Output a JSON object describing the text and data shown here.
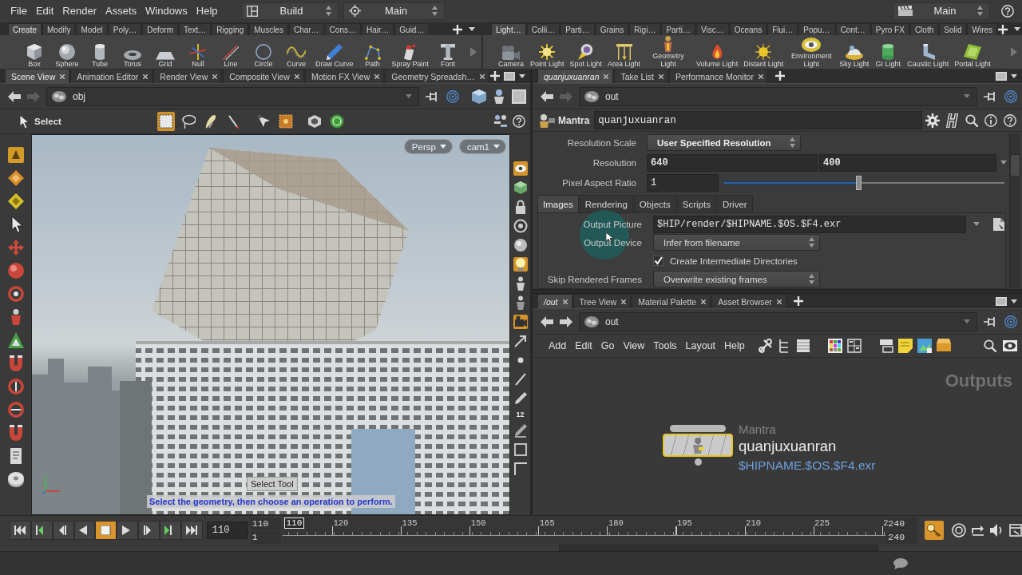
{
  "menu_bar": {
    "menus": [
      "File",
      "Edit",
      "Render",
      "Assets",
      "Windows",
      "Help"
    ],
    "desktop": "Build",
    "context": "Main",
    "right_context": "Main"
  },
  "shelves": [
    {
      "tabs": [
        {
          "label": "Create",
          "selected": true
        },
        {
          "label": "Modify",
          "selected": false
        },
        {
          "label": "Model",
          "selected": false
        },
        {
          "label": "Poly…",
          "selected": false
        },
        {
          "label": "Deform",
          "selected": false
        },
        {
          "label": "Text…",
          "selected": false
        },
        {
          "label": "Rigging",
          "selected": false
        },
        {
          "label": "Muscles",
          "selected": false
        },
        {
          "label": "Char…",
          "selected": false
        },
        {
          "label": "Cons…",
          "selected": false
        },
        {
          "label": "Hair…",
          "selected": false
        },
        {
          "label": "Guid…",
          "selected": false
        }
      ],
      "tools": [
        "Box",
        "Sphere",
        "Tube",
        "Torus",
        "Grid",
        "Null",
        "Line",
        "Circle",
        "Curve",
        "Draw Curve",
        "Path",
        "Spray Paint",
        "Font"
      ]
    },
    {
      "tabs": [
        {
          "label": "Light…",
          "selected": true
        },
        {
          "label": "Colli…",
          "selected": false
        },
        {
          "label": "Parti…",
          "selected": false
        },
        {
          "label": "Grains",
          "selected": false
        },
        {
          "label": "Rigi…",
          "selected": false
        },
        {
          "label": "Parti…",
          "selected": false
        },
        {
          "label": "Visc…",
          "selected": false
        },
        {
          "label": "Oceans",
          "selected": false
        },
        {
          "label": "Flui…",
          "selected": false
        },
        {
          "label": "Popu…",
          "selected": false
        },
        {
          "label": "Cont…",
          "selected": false
        },
        {
          "label": "Pyro FX",
          "selected": false
        },
        {
          "label": "Cloth",
          "selected": false
        },
        {
          "label": "Solid",
          "selected": false
        },
        {
          "label": "Wires",
          "selected": false
        }
      ],
      "tools": [
        "Camera",
        "Point Light",
        "Spot Light",
        "Area Light",
        "Geometry Light",
        "Volume Light",
        "Distant Light",
        "Environment Light",
        "Sky Light",
        "GI Light",
        "Caustic Light",
        "Portal Light"
      ]
    }
  ],
  "scene_pane": {
    "tabs": [
      {
        "label": "Scene View",
        "selected": true,
        "kind": "view"
      },
      {
        "label": "Animation Editor",
        "selected": false,
        "kind": "view"
      },
      {
        "label": "Render View",
        "selected": false,
        "kind": "view"
      },
      {
        "label": "Composite View",
        "selected": false,
        "kind": "view"
      },
      {
        "label": "Motion FX View",
        "selected": false,
        "kind": "view"
      },
      {
        "label": "Geometry Spreadsh…",
        "selected": false,
        "kind": "view"
      }
    ],
    "path": "obj",
    "forward_enabled": false,
    "tool": "Select",
    "selection_modes": [
      {
        "selected": true
      },
      {
        "selected": false
      },
      {
        "selected": false
      },
      {
        "selected": false
      }
    ],
    "view_menus": [
      "Persp",
      "cam1"
    ],
    "tooltip": "Select Tool",
    "prompt": "Select the geometry, then choose an operation to perform.",
    "display_options": [
      {
        "on": true
      },
      {
        "on": false
      },
      {
        "on": false
      },
      {
        "on": false
      },
      {
        "on": false
      },
      {
        "on": true
      },
      {
        "on": false
      },
      {
        "on": false
      },
      {
        "on": true
      },
      {
        "on": false
      },
      {
        "on": false
      },
      {
        "on": false
      },
      {
        "on": false
      },
      {
        "on": false
      },
      {
        "on": false
      },
      {
        "on": false
      }
    ],
    "column_label": "12"
  },
  "parameter_pane": {
    "tabs": [
      {
        "label": "quanjuxuanran",
        "selected": true,
        "kind": "path"
      },
      {
        "label": "Take List",
        "selected": false,
        "kind": "view"
      },
      {
        "label": "Performance Monitor",
        "selected": false,
        "kind": "view"
      }
    ],
    "path": "out",
    "forward_enabled": false,
    "node_type": "Mantra",
    "node_name": "quanjuxuanran",
    "parameters": [
      {
        "kind": "menu",
        "label": "Resolution Scale",
        "value": "User Specified Resolution",
        "changed": true
      },
      {
        "kind": "pair",
        "label": "Resolution",
        "values": [
          "640",
          "400"
        ],
        "changed": true
      },
      {
        "kind": "slider",
        "label": "Pixel Aspect Ratio",
        "value": "1",
        "level": 0.48,
        "changed": false
      }
    ],
    "folders": [
      {
        "label": "Images",
        "selected": true
      },
      {
        "label": "Rendering",
        "selected": false
      },
      {
        "label": "Objects",
        "selected": false
      },
      {
        "label": "Scripts",
        "selected": false
      },
      {
        "label": "Driver",
        "selected": false
      }
    ],
    "folder_parameters": [
      {
        "kind": "file",
        "label": "Output Picture",
        "value": "$HIP/render/$HIPNAME.$OS.$F4.exr",
        "changed": false
      },
      {
        "kind": "menu",
        "label": "Output Device",
        "value": "Infer from filename",
        "changed": false
      },
      {
        "kind": "checkbox",
        "label": "Create Intermediate Directories",
        "checked": true
      },
      {
        "kind": "menu",
        "label": "Skip Rendered Frames",
        "value": "Overwrite existing frames",
        "changed": false
      }
    ]
  },
  "network_pane": {
    "tabs": [
      {
        "label": "/out",
        "selected": true,
        "kind": "path"
      },
      {
        "label": "Tree View",
        "selected": false,
        "kind": "view"
      },
      {
        "label": "Material Palette",
        "selected": false,
        "kind": "view"
      },
      {
        "label": "Asset Browser",
        "selected": false,
        "kind": "view"
      }
    ],
    "path": "out",
    "forward_enabled": true,
    "menus": [
      "Add",
      "Edit",
      "Go",
      "View",
      "Tools",
      "Layout",
      "Help"
    ],
    "context_label": "Outputs",
    "node": {
      "type": "Mantra",
      "name": "quanjuxuanran",
      "output": "$HIPNAME.$OS.$F4.exr",
      "selected": true
    }
  },
  "timeline": {
    "playback_buttons": [
      {
        "kind": "first",
        "selected": false
      },
      {
        "kind": "prev_key",
        "selected": false
      },
      {
        "kind": "step_back",
        "selected": false
      },
      {
        "kind": "reverse",
        "selected": false
      },
      {
        "kind": "stop",
        "selected": true
      },
      {
        "kind": "play",
        "selected": false
      },
      {
        "kind": "step_forward",
        "selected": false
      },
      {
        "kind": "next_key",
        "selected": false
      },
      {
        "kind": "last",
        "selected": false
      }
    ],
    "current_frame": "110",
    "range_start": "110",
    "global_start": "1",
    "ruler_frame": "110",
    "ruler_labels": [
      "120",
      "135",
      "150",
      "165",
      "180",
      "195",
      "210",
      "225",
      "2"
    ],
    "range_end": "240",
    "global_end": "240",
    "auto_key": true
  }
}
